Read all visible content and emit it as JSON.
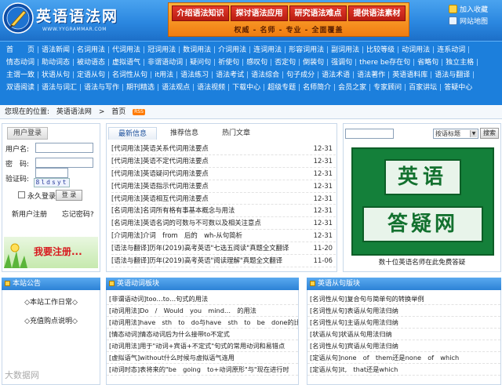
{
  "header": {
    "logo_title": "英语语法网",
    "logo_url": "WWW.YYGRAMMAR.COM",
    "promo_buttons": [
      "介绍语法知识",
      "探讨语法应用",
      "研究语法难点",
      "提供语法素材"
    ],
    "promo_slogan": "权威 - 名师 - 专业 - 全面覆盖",
    "links": [
      {
        "label": "加入收藏",
        "icon": "star-icon"
      },
      {
        "label": "网站地图",
        "icon": "sitemap-icon"
      }
    ]
  },
  "nav": {
    "items": [
      "首　　页",
      "语法新闻",
      "名词用法",
      "代词用法",
      "冠词用法",
      "数词用法",
      "介词用法",
      "连词用法",
      "形容词用法",
      "副词用法",
      "比较等级",
      "动词用法",
      "连系动词",
      "情态动词",
      "助动词态",
      "被动语态",
      "虚拟语气",
      "非谓语动词",
      "疑问句",
      "祈使句",
      "感叹句",
      "否定句",
      "倒装句",
      "强调句",
      "there be存在句",
      "省略句",
      "独立主格",
      "主谓一致",
      "状语从句",
      "定语从句",
      "名词性从句",
      "it用法",
      "语法练习",
      "语法考试",
      "语法综合",
      "句子成分",
      "语法术语",
      "语法著作",
      "英语语料库",
      "语法与翻译",
      "双语阅读",
      "语法与词汇",
      "语法与写作",
      "期刊精选",
      "语法观点",
      "语法视频",
      "下载中心",
      "超级专题",
      "名师简介",
      "会员之家",
      "专家顾问",
      "百家讲坛",
      "答疑中心"
    ]
  },
  "breadcrumb": {
    "label": "您现在的位置:",
    "site": "英语语法网",
    "current": "首页",
    "badge": "RSS"
  },
  "login": {
    "title": "用户登录",
    "username_label": "用户名:",
    "password_label": "密　码:",
    "captcha_label": "验证码:",
    "captcha_value": "8ldsyt",
    "remember_label": "永久登录",
    "login_button": "登 录",
    "register_link": "新用户注册",
    "forgot_link": "忘记密码?",
    "banner_text": "我要注册..."
  },
  "news": {
    "tabs": [
      "最新信息",
      "推荐信息",
      "热门文章"
    ],
    "active_tab": 0,
    "rows": [
      {
        "title": "[代词用法]英语关系代词用法要点",
        "date": "12-31"
      },
      {
        "title": "[代词用法]英语不定代词用法要点",
        "date": "12-31"
      },
      {
        "title": "[代词用法]英语疑问代词用法要点",
        "date": "12-31"
      },
      {
        "title": "[代词用法]英语指示代词用法要点",
        "date": "12-31"
      },
      {
        "title": "[代词用法]英语相互代词用法要点",
        "date": "12-31"
      },
      {
        "title": "[名词用法]名词所有格有事基本概念与用法",
        "date": "12-31"
      },
      {
        "title": "[名词用法]英语名词的可数与不可数以及相关注意点",
        "date": "12-31"
      },
      {
        "title": "[介词用法]介词　from　后的　wh-从句简析",
        "date": "12-31"
      },
      {
        "title": "[语法与翻译]历年(2019)高考英语\"七选五阅读\"真题全文翻译",
        "date": "11-20"
      },
      {
        "title": "[语法与翻译]历年(2019)高考英语\"阅读理解\"真题全文翻译",
        "date": "11-06"
      }
    ]
  },
  "search": {
    "select_value": "按语标题",
    "button_label": "搜索"
  },
  "qa_banner": {
    "line1": "英语",
    "line2": "答疑网",
    "caption": "数十位英语名师在此免费答疑"
  },
  "notice": {
    "title": "本站公告",
    "items": [
      "◇本站工作日常◇",
      "◇充值购点说明◇"
    ]
  },
  "verb_panel": {
    "title": "英语动词板块",
    "rows": [
      "[非谓语动词]too…to…句式的用法",
      "[动词用法]Do　/　Would　you　mind…　的用法",
      "[动词用法]have　sth　to　do与have　sth　to　be　done的比较",
      "[情态动词]情态动词后为什么接带to不定式",
      "[动词用法]用于\"动词+宾语+不定式\"句式的常用动词和易错点",
      "[虚拟语气]without什么时候与虚拟语气连用",
      "[动词时态]表将来的\"be　going　to+动词原形\"与\"现在进行时"
    ]
  },
  "clause_panel": {
    "title": "英语从句版块",
    "rows": [
      "[名词性从句]复合句与简单句的转换举例",
      "[名词性从句]表语从句用法归纳",
      "[名词性从句]主语从句用法归纳",
      "[状语从句]状语从句用法归纳",
      "[名词性从句]宾语从句用法归纳",
      "[定语从句]none　of　them还是none　of　which",
      "[定语从句]it,　that还是which"
    ]
  },
  "watermark": "大数据网"
}
